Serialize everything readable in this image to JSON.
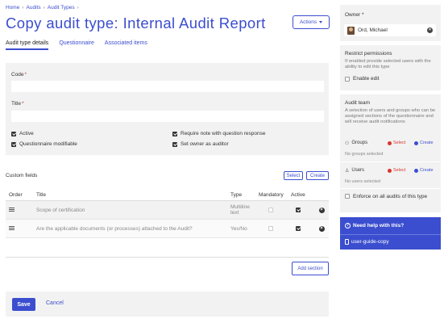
{
  "breadcrumb": [
    "Home",
    "Audits",
    "Audit Types"
  ],
  "page_title": "Copy audit type: Internal Audit Report",
  "actions_label": "Actions",
  "tabs": [
    {
      "label": "Audit type details",
      "active": true
    },
    {
      "label": "Questionnaire",
      "active": false
    },
    {
      "label": "Associated items",
      "active": false
    }
  ],
  "form": {
    "code_label": "Code",
    "code_value": "",
    "title_label": "Title",
    "title_value": "",
    "required_marker": "*",
    "checkboxes": [
      {
        "label": "Active",
        "checked": true
      },
      {
        "label": "Questionnaire modifiable",
        "checked": true
      },
      {
        "label": "Require note with question response",
        "checked": true
      },
      {
        "label": "Set owner as auditor",
        "checked": true
      }
    ]
  },
  "custom_fields": {
    "label": "Custom fields",
    "select_label": "Select",
    "create_label": "Create",
    "columns": [
      "Order",
      "Title",
      "Type",
      "Mandatory",
      "Active"
    ],
    "rows": [
      {
        "title": "Scope of certification",
        "type": "Multiline text",
        "mandatory": false,
        "active": true
      },
      {
        "title": "Are the applicable documents (or processes) attached to the Audit?",
        "type": "Yes/No",
        "mandatory": false,
        "active": true
      }
    ]
  },
  "add_section_label": "Add section",
  "footer": {
    "save_label": "Save",
    "cancel_label": "Cancel"
  },
  "sidebar": {
    "owner": {
      "label": "Owner",
      "required_marker": "*",
      "value": "Ord, Michael"
    },
    "restrict": {
      "title": "Restrict permissions",
      "description": "If enabled provide selected users with the ability to edit this type",
      "checkbox_label": "Enable edit",
      "checked": false
    },
    "audit_team": {
      "title": "Audit team",
      "description": "A selection of users and groups who can be assigned sections of the questionnaire and will receive audit notifications",
      "groups_label": "Groups",
      "groups_empty": "No groups selected",
      "users_label": "Users",
      "users_empty": "No users selected",
      "select_label": "Select",
      "create_label": "Create",
      "enforce_label": "Enforce on all audits of this type",
      "enforce_checked": false
    },
    "help": {
      "title": "Need help with this?",
      "link": "user-guide-copy"
    }
  },
  "colors": {
    "accent": "#3b4ecf",
    "danger": "#d9342c",
    "panel_bg": "#f2f2f2"
  }
}
